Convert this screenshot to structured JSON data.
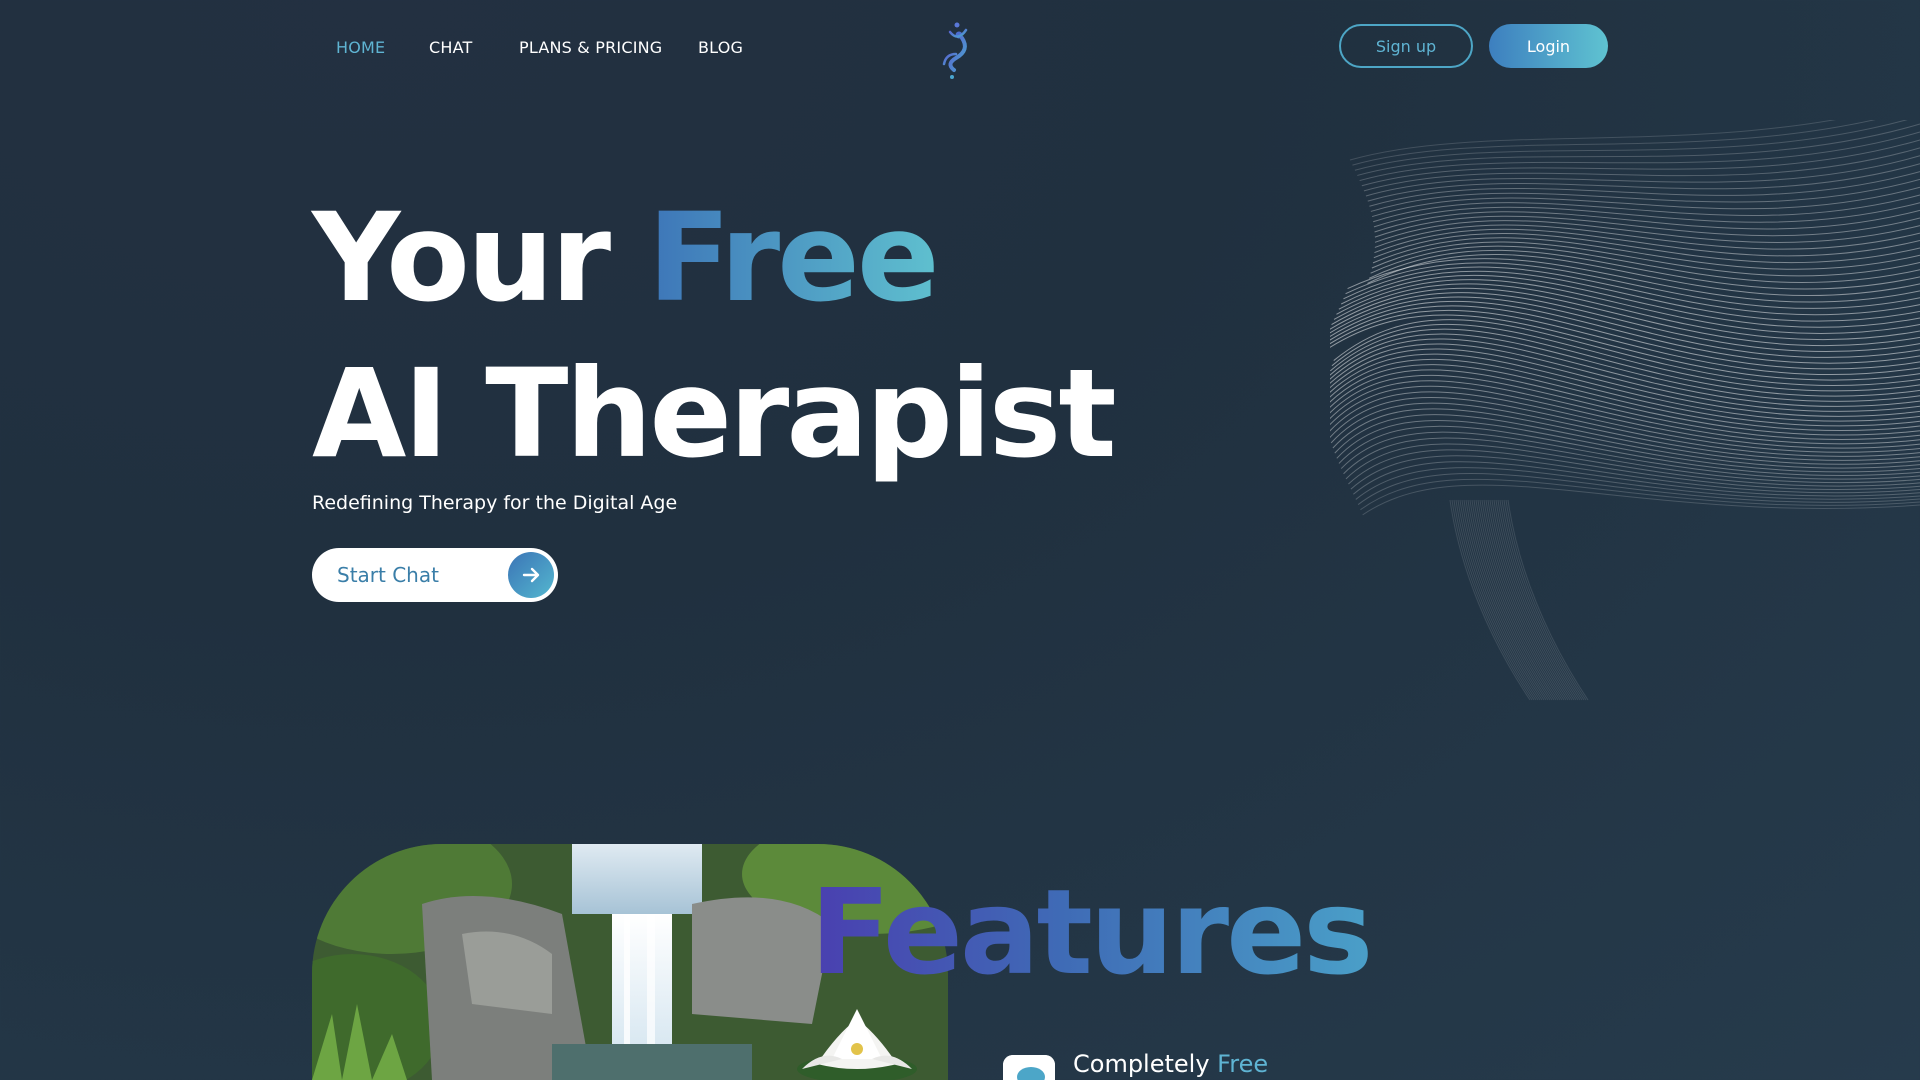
{
  "nav": {
    "items": [
      {
        "label": "HOME",
        "active": true
      },
      {
        "label": "CHAT",
        "active": false
      },
      {
        "label": "PLANS & PRICING",
        "active": false
      },
      {
        "label": "BLOG",
        "active": false
      }
    ],
    "logo_icon": "dancing-figure-logo-icon",
    "signup_label": "Sign up",
    "login_label": "Login"
  },
  "hero": {
    "title_line1_plain": "Your ",
    "title_line1_accent": "Free",
    "title_line2": "AI Therapist",
    "subtitle": "Redefining Therapy for the Digital Age",
    "cta_label": "Start Chat",
    "cta_icon": "arrow-right-icon",
    "art": "wireframe-face-art"
  },
  "features": {
    "title": "Features",
    "image": "waterfall-lotus-image",
    "items": [
      {
        "icon": "chat-bubble-icon",
        "label_plain": "Completely ",
        "label_accent": "Free"
      }
    ]
  },
  "colors": {
    "accent": "#5fb4d3",
    "accent_gradient_start": "#3d75b8",
    "accent_gradient_end": "#5fc0cf",
    "features_gradient_start": "#4a3fb0",
    "background": "#233041"
  }
}
